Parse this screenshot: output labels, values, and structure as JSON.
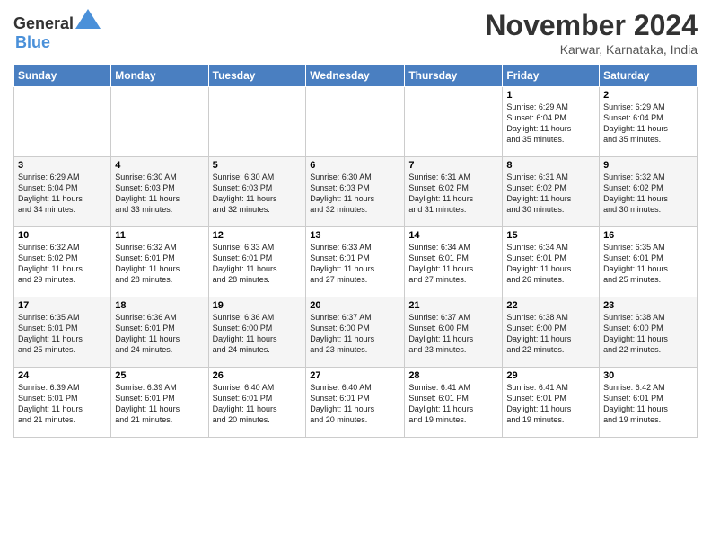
{
  "header": {
    "logo_general": "General",
    "logo_blue": "Blue",
    "month_title": "November 2024",
    "location": "Karwar, Karnataka, India"
  },
  "days_of_week": [
    "Sunday",
    "Monday",
    "Tuesday",
    "Wednesday",
    "Thursday",
    "Friday",
    "Saturday"
  ],
  "weeks": [
    [
      {
        "day": "",
        "info": ""
      },
      {
        "day": "",
        "info": ""
      },
      {
        "day": "",
        "info": ""
      },
      {
        "day": "",
        "info": ""
      },
      {
        "day": "",
        "info": ""
      },
      {
        "day": "1",
        "info": "Sunrise: 6:29 AM\nSunset: 6:04 PM\nDaylight: 11 hours\nand 35 minutes."
      },
      {
        "day": "2",
        "info": "Sunrise: 6:29 AM\nSunset: 6:04 PM\nDaylight: 11 hours\nand 35 minutes."
      }
    ],
    [
      {
        "day": "3",
        "info": "Sunrise: 6:29 AM\nSunset: 6:04 PM\nDaylight: 11 hours\nand 34 minutes."
      },
      {
        "day": "4",
        "info": "Sunrise: 6:30 AM\nSunset: 6:03 PM\nDaylight: 11 hours\nand 33 minutes."
      },
      {
        "day": "5",
        "info": "Sunrise: 6:30 AM\nSunset: 6:03 PM\nDaylight: 11 hours\nand 32 minutes."
      },
      {
        "day": "6",
        "info": "Sunrise: 6:30 AM\nSunset: 6:03 PM\nDaylight: 11 hours\nand 32 minutes."
      },
      {
        "day": "7",
        "info": "Sunrise: 6:31 AM\nSunset: 6:02 PM\nDaylight: 11 hours\nand 31 minutes."
      },
      {
        "day": "8",
        "info": "Sunrise: 6:31 AM\nSunset: 6:02 PM\nDaylight: 11 hours\nand 30 minutes."
      },
      {
        "day": "9",
        "info": "Sunrise: 6:32 AM\nSunset: 6:02 PM\nDaylight: 11 hours\nand 30 minutes."
      }
    ],
    [
      {
        "day": "10",
        "info": "Sunrise: 6:32 AM\nSunset: 6:02 PM\nDaylight: 11 hours\nand 29 minutes."
      },
      {
        "day": "11",
        "info": "Sunrise: 6:32 AM\nSunset: 6:01 PM\nDaylight: 11 hours\nand 28 minutes."
      },
      {
        "day": "12",
        "info": "Sunrise: 6:33 AM\nSunset: 6:01 PM\nDaylight: 11 hours\nand 28 minutes."
      },
      {
        "day": "13",
        "info": "Sunrise: 6:33 AM\nSunset: 6:01 PM\nDaylight: 11 hours\nand 27 minutes."
      },
      {
        "day": "14",
        "info": "Sunrise: 6:34 AM\nSunset: 6:01 PM\nDaylight: 11 hours\nand 27 minutes."
      },
      {
        "day": "15",
        "info": "Sunrise: 6:34 AM\nSunset: 6:01 PM\nDaylight: 11 hours\nand 26 minutes."
      },
      {
        "day": "16",
        "info": "Sunrise: 6:35 AM\nSunset: 6:01 PM\nDaylight: 11 hours\nand 25 minutes."
      }
    ],
    [
      {
        "day": "17",
        "info": "Sunrise: 6:35 AM\nSunset: 6:01 PM\nDaylight: 11 hours\nand 25 minutes."
      },
      {
        "day": "18",
        "info": "Sunrise: 6:36 AM\nSunset: 6:01 PM\nDaylight: 11 hours\nand 24 minutes."
      },
      {
        "day": "19",
        "info": "Sunrise: 6:36 AM\nSunset: 6:00 PM\nDaylight: 11 hours\nand 24 minutes."
      },
      {
        "day": "20",
        "info": "Sunrise: 6:37 AM\nSunset: 6:00 PM\nDaylight: 11 hours\nand 23 minutes."
      },
      {
        "day": "21",
        "info": "Sunrise: 6:37 AM\nSunset: 6:00 PM\nDaylight: 11 hours\nand 23 minutes."
      },
      {
        "day": "22",
        "info": "Sunrise: 6:38 AM\nSunset: 6:00 PM\nDaylight: 11 hours\nand 22 minutes."
      },
      {
        "day": "23",
        "info": "Sunrise: 6:38 AM\nSunset: 6:00 PM\nDaylight: 11 hours\nand 22 minutes."
      }
    ],
    [
      {
        "day": "24",
        "info": "Sunrise: 6:39 AM\nSunset: 6:01 PM\nDaylight: 11 hours\nand 21 minutes."
      },
      {
        "day": "25",
        "info": "Sunrise: 6:39 AM\nSunset: 6:01 PM\nDaylight: 11 hours\nand 21 minutes."
      },
      {
        "day": "26",
        "info": "Sunrise: 6:40 AM\nSunset: 6:01 PM\nDaylight: 11 hours\nand 20 minutes."
      },
      {
        "day": "27",
        "info": "Sunrise: 6:40 AM\nSunset: 6:01 PM\nDaylight: 11 hours\nand 20 minutes."
      },
      {
        "day": "28",
        "info": "Sunrise: 6:41 AM\nSunset: 6:01 PM\nDaylight: 11 hours\nand 19 minutes."
      },
      {
        "day": "29",
        "info": "Sunrise: 6:41 AM\nSunset: 6:01 PM\nDaylight: 11 hours\nand 19 minutes."
      },
      {
        "day": "30",
        "info": "Sunrise: 6:42 AM\nSunset: 6:01 PM\nDaylight: 11 hours\nand 19 minutes."
      }
    ]
  ]
}
